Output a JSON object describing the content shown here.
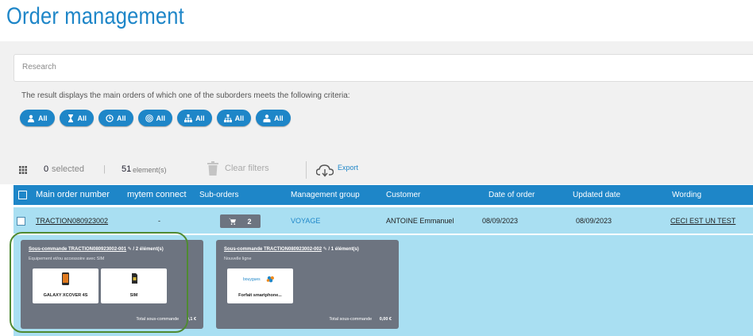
{
  "page_title": "Order management",
  "search": {
    "placeholder": "Research"
  },
  "criteria_text": "The result displays the main orders of which one of the suborders meets the following criteria:",
  "filters": [
    {
      "label": "All",
      "icon": "user-icon"
    },
    {
      "label": "All",
      "icon": "hourglass-icon"
    },
    {
      "label": "All",
      "icon": "clock-icon"
    },
    {
      "label": "All",
      "icon": "signal-icon"
    },
    {
      "label": "All",
      "icon": "network-icon"
    },
    {
      "label": "All",
      "icon": "sitemap-icon"
    },
    {
      "label": "All",
      "icon": "user-tie-icon"
    }
  ],
  "toolbar": {
    "selected_count": "0",
    "selected_label": "selected",
    "separator": "|",
    "elements_count": "51",
    "elements_label": "element(s)",
    "clear_filters": "Clear filters",
    "export": "Export"
  },
  "table": {
    "headers": [
      "Main order number",
      "mytem connect",
      "Sub-orders",
      "Management group",
      "Customer",
      "Date of order",
      "Updated date",
      "Wording"
    ],
    "row": {
      "order_number": "TRACTION080923002",
      "mytem_connect": "-",
      "suborders_count": "2",
      "management_group": "VOYAGE",
      "customer": "ANTOINE Emmanuel",
      "date_of_order": "08/09/2023",
      "updated_date": "08/09/2023",
      "wording": "CECI EST UN TEST"
    }
  },
  "suborders": [
    {
      "title": "Sous-commande TRACTION080923002-001",
      "edit": "✎",
      "count": "/ 2 élément(s)",
      "category": "Equipement et/ou accessoire avec SIM",
      "products": [
        "GALAXY XCOVER 4S",
        "SIM"
      ],
      "total_label": "Total sous-commande",
      "total_value": "0,1 €"
    },
    {
      "title": "Sous-commande TRACTION080923002-002",
      "edit": "✎",
      "count": "/ 1 élément(s)",
      "category": "Nouvelle ligne",
      "products": [
        "Forfait smartphone..."
      ],
      "brand": "bouygues",
      "total_label": "Total sous-commande",
      "total_value": "0,00 €"
    }
  ],
  "colors": {
    "accent": "#1e86c8",
    "row_bg": "#a9dff2",
    "card_bg": "#6d7480",
    "highlight": "#4f8a32"
  }
}
